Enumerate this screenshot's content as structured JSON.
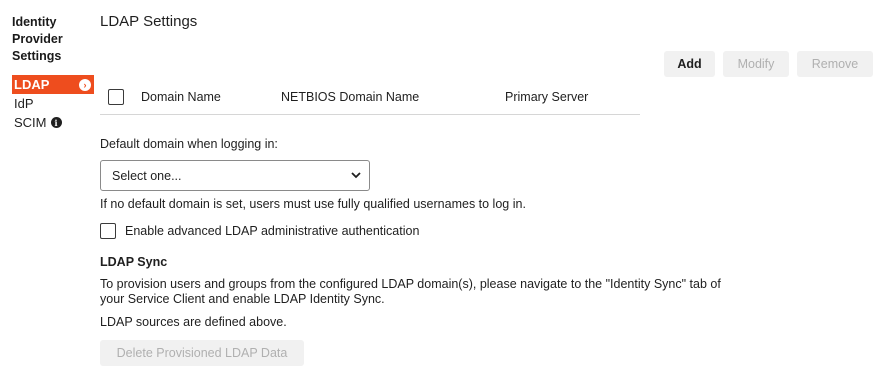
{
  "sidebar": {
    "title": "Identity Provider Settings",
    "items": [
      {
        "label": "LDAP"
      },
      {
        "label": "IdP"
      },
      {
        "label": "SCIM"
      }
    ]
  },
  "main": {
    "title": "LDAP Settings",
    "buttons": {
      "add": "Add",
      "modify": "Modify",
      "remove": "Remove"
    },
    "table": {
      "columns": [
        "Domain Name",
        "NETBIOS Domain Name",
        "Primary Server"
      ]
    },
    "default_domain_label": "Default domain when logging in:",
    "select_value": "Select one...",
    "default_domain_help": "If no default domain is set, users must use fully qualified usernames to log in.",
    "advanced_auth_label": "Enable advanced LDAP administrative authentication",
    "sync": {
      "title": "LDAP Sync",
      "line1": "To provision users and groups from the configured LDAP domain(s), please navigate to the \"Identity Sync\" tab of",
      "line2": "your Service Client and enable LDAP Identity Sync.",
      "line3": "LDAP sources are defined above.",
      "delete_button": "Delete Provisioned LDAP Data"
    }
  },
  "colors": {
    "accent": "#ee4d1e",
    "disabled_text": "#b0b0b0",
    "button_bg": "#f1f1f1"
  }
}
